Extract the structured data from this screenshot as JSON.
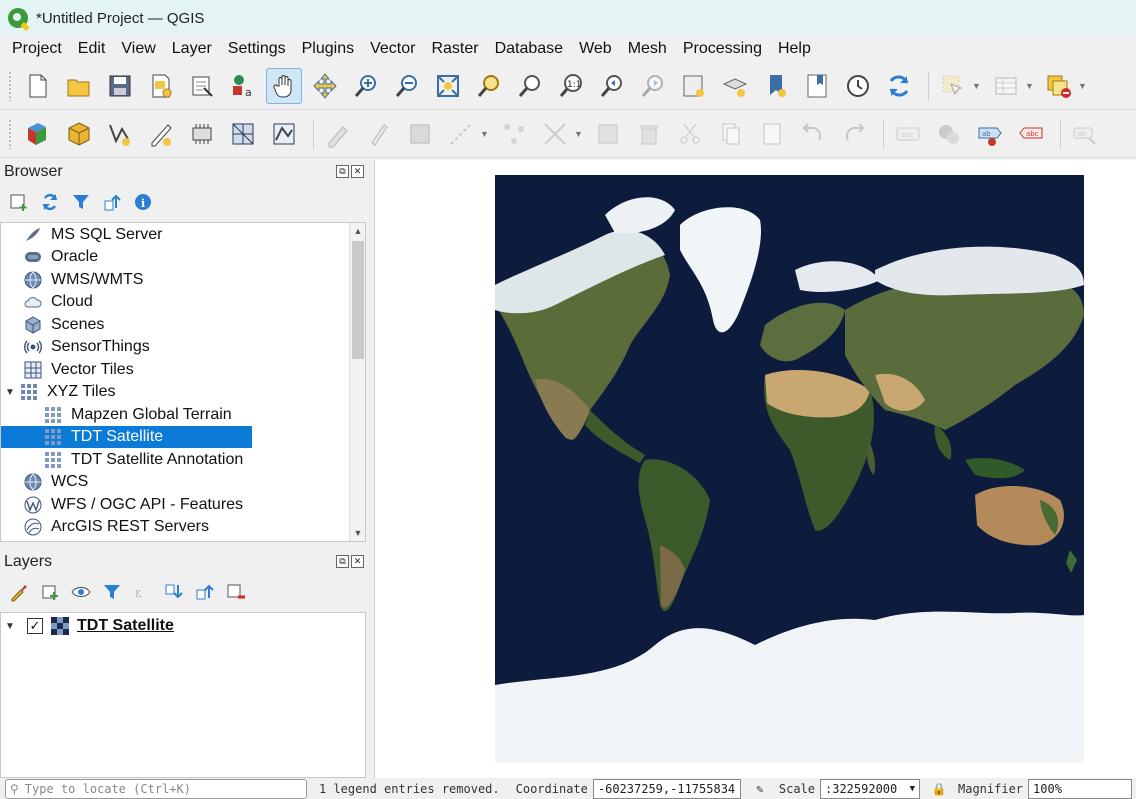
{
  "window": {
    "title": "*Untitled Project — QGIS"
  },
  "menu": [
    "Project",
    "Edit",
    "View",
    "Layer",
    "Settings",
    "Plugins",
    "Vector",
    "Raster",
    "Database",
    "Web",
    "Mesh",
    "Processing",
    "Help"
  ],
  "toolbar1": [
    {
      "icon": "new-project-icon"
    },
    {
      "icon": "open-project-icon"
    },
    {
      "icon": "save-project-icon"
    },
    {
      "icon": "new-print-layout-icon"
    },
    {
      "icon": "layout-manager-icon"
    },
    {
      "icon": "style-manager-icon"
    },
    {
      "icon": "pan-map-icon",
      "active": true
    },
    {
      "icon": "pan-to-selection-icon"
    },
    {
      "icon": "zoom-in-icon"
    },
    {
      "icon": "zoom-out-icon"
    },
    {
      "icon": "zoom-full-icon"
    },
    {
      "icon": "zoom-to-selection-icon"
    },
    {
      "icon": "zoom-to-layer-icon"
    },
    {
      "icon": "zoom-native-resolution-icon"
    },
    {
      "icon": "zoom-last-icon"
    },
    {
      "icon": "zoom-next-icon"
    },
    {
      "icon": "new-map-view-icon"
    },
    {
      "icon": "new-3d-map-view-icon"
    },
    {
      "icon": "new-spatial-bookmark-icon"
    },
    {
      "icon": "show-bookmarks-icon"
    },
    {
      "icon": "temporal-controller-icon"
    },
    {
      "icon": "refresh-icon"
    },
    {
      "icon": "select-features-icon"
    },
    {
      "icon": "attribute-table-icon"
    },
    {
      "icon": "deselect-all-icon"
    }
  ],
  "toolbar2": [
    {
      "icon": "data-source-manager-icon"
    },
    {
      "icon": "new-geopackage-layer-icon"
    },
    {
      "icon": "new-shapefile-layer-icon"
    },
    {
      "icon": "new-temporary-layer-icon"
    },
    {
      "icon": "new-virtual-layer-icon"
    },
    {
      "icon": "new-mesh-layer-icon"
    },
    {
      "icon": "new-vector-tile-layer-icon"
    },
    {
      "icon": "current-edits-icon"
    },
    {
      "icon": "toggle-editing-icon"
    },
    {
      "icon": "save-edits-icon"
    },
    {
      "icon": "digitize-icon"
    },
    {
      "icon": "vertex-tool-icon"
    },
    {
      "icon": "modify-attributes-icon"
    },
    {
      "icon": "delete-selected-icon"
    },
    {
      "icon": "cut-features-icon"
    },
    {
      "icon": "copy-features-icon"
    },
    {
      "icon": "paste-features-icon"
    },
    {
      "icon": "undo-icon"
    },
    {
      "icon": "redo-icon"
    },
    {
      "icon": "label-toolbar-icon"
    },
    {
      "icon": "diagram-icon"
    },
    {
      "icon": "pin-labels-icon"
    },
    {
      "icon": "highlight-labels-icon"
    },
    {
      "icon": "move-label-icon"
    }
  ],
  "browser": {
    "title": "Browser",
    "items": [
      {
        "label": "MS SQL Server",
        "icon": "mssql-icon",
        "indent": 0
      },
      {
        "label": "Oracle",
        "icon": "oracle-icon",
        "indent": 0
      },
      {
        "label": "WMS/WMTS",
        "icon": "wms-icon",
        "indent": 0
      },
      {
        "label": "Cloud",
        "icon": "cloud-icon",
        "indent": 0
      },
      {
        "label": "Scenes",
        "icon": "scenes-icon",
        "indent": 0
      },
      {
        "label": "SensorThings",
        "icon": "sensorthings-icon",
        "indent": 0
      },
      {
        "label": "Vector Tiles",
        "icon": "vector-tiles-icon",
        "indent": 0
      },
      {
        "label": "XYZ Tiles",
        "icon": "xyz-tiles-icon",
        "indent": 0,
        "expanded": true
      },
      {
        "label": "Mapzen Global Terrain",
        "icon": "xyz-tile-layer-icon",
        "indent": 1
      },
      {
        "label": "TDT Satellite",
        "icon": "xyz-tile-layer-icon",
        "indent": 1,
        "selected": true
      },
      {
        "label": "TDT Satellite Annotation",
        "icon": "xyz-tile-layer-icon",
        "indent": 1
      },
      {
        "label": "WCS",
        "icon": "wcs-icon",
        "indent": 0
      },
      {
        "label": "WFS / OGC API - Features",
        "icon": "wfs-icon",
        "indent": 0
      },
      {
        "label": "ArcGIS REST Servers",
        "icon": "arcgis-icon",
        "indent": 0
      }
    ]
  },
  "layers": {
    "title": "Layers",
    "items": [
      {
        "label": "TDT Satellite",
        "checked": true
      }
    ]
  },
  "statusbar": {
    "locate_placeholder": "Type to locate (Ctrl+K)",
    "message": "1 legend entries removed.",
    "coordinate_label": "Coordinate",
    "coordinate_value": "-60237259,-11755834",
    "scale_label": "Scale",
    "scale_value": ":322592000",
    "magnifier_label": "Magnifier",
    "magnifier_value": "100%"
  },
  "colors": {
    "selection": "#0c7bd8",
    "ocean": "#0d1b3d",
    "accent": "#f2c811"
  }
}
